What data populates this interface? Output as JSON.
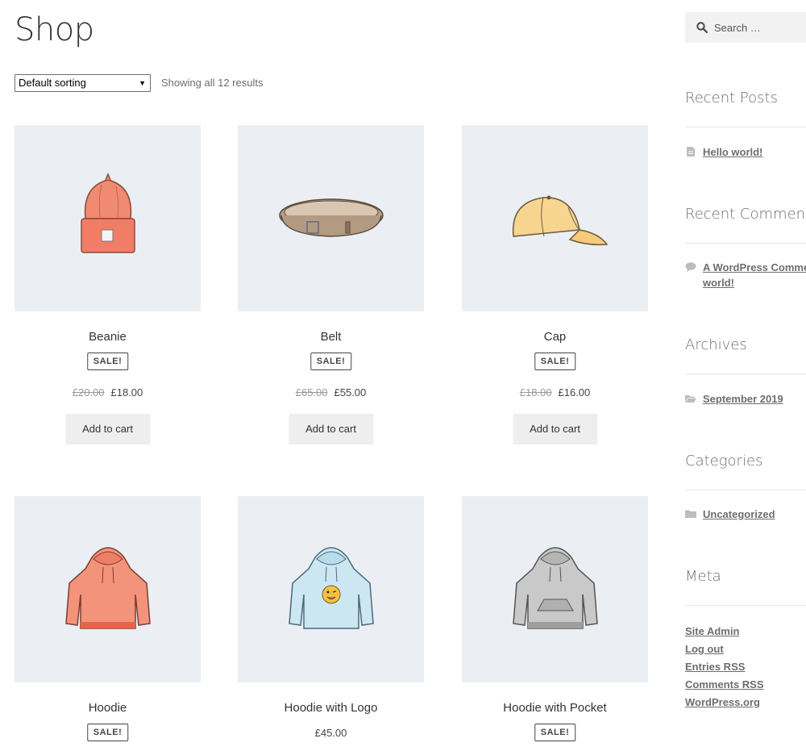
{
  "page": {
    "title": "Shop"
  },
  "toolbar": {
    "sorting_value": "Default sorting",
    "result_count": "Showing all 12 results"
  },
  "products": [
    {
      "name": "Beanie",
      "sale_badge": "SALE!",
      "old_price": "£20.00",
      "price": "£18.00",
      "cart_label": "Add to cart",
      "image": "beanie-image"
    },
    {
      "name": "Belt",
      "sale_badge": "SALE!",
      "old_price": "£65.00",
      "price": "£55.00",
      "cart_label": "Add to cart",
      "image": "belt-image"
    },
    {
      "name": "Cap",
      "sale_badge": "SALE!",
      "old_price": "£18.00",
      "price": "£16.00",
      "cart_label": "Add to cart",
      "image": "cap-image"
    },
    {
      "name": "Hoodie",
      "sale_badge": "SALE!",
      "image": "hoodie-image"
    },
    {
      "name": "Hoodie with Logo",
      "price": "£45.00",
      "image": "hoodie-logo-image"
    },
    {
      "name": "Hoodie with Pocket",
      "sale_badge": "SALE!",
      "image": "hoodie-pocket-image"
    }
  ],
  "sidebar": {
    "search_placeholder": "Search …",
    "recent_posts": {
      "title": "Recent Posts",
      "items": [
        "Hello world!"
      ]
    },
    "recent_comments": {
      "title": "Recent Comments",
      "line1": "A WordPress Commenter",
      "line2": "world!"
    },
    "archives": {
      "title": "Archives",
      "items": [
        "September 2019"
      ]
    },
    "categories": {
      "title": "Categories",
      "items": [
        "Uncategorized"
      ]
    },
    "meta": {
      "title": "Meta",
      "items": [
        "Site Admin",
        "Log out",
        "Entries RSS",
        "Comments RSS",
        "WordPress.org"
      ]
    }
  },
  "colors": {
    "thumb_bg": "#ebeff3",
    "button_bg": "#eeeeee",
    "text": "#43454b",
    "muted": "#6d6d6d"
  }
}
